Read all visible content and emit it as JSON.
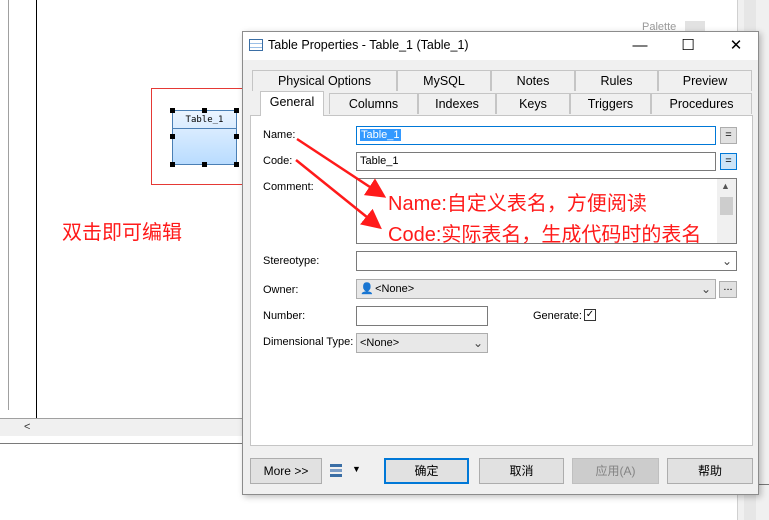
{
  "background": {
    "palette_label": "Palette",
    "scroll_left_glyph": "<",
    "annotation_left": "双击即可编辑"
  },
  "table_symbol": {
    "name": "Table_1"
  },
  "dialog": {
    "title": "Table Properties - Table_1 (Table_1)",
    "window_buttons": {
      "minimize": "—",
      "maximize": "☐",
      "close": "✕"
    },
    "tabs_row1": [
      "Physical Options",
      "MySQL",
      "Notes",
      "Rules",
      "Preview"
    ],
    "tabs_row2": [
      "General",
      "Columns",
      "Indexes",
      "Keys",
      "Triggers",
      "Procedures"
    ],
    "active_tab": "General",
    "fields": {
      "name_label": "Name:",
      "name_value": "Table_1",
      "code_label": "Code:",
      "code_value": "Table_1",
      "comment_label": "Comment:",
      "stereotype_label": "Stereotype:",
      "stereotype_value": "",
      "owner_label": "Owner:",
      "owner_value": "<None>",
      "number_label": "Number:",
      "number_value": "",
      "generate_label": "Generate:",
      "generate_checked": true,
      "dimensional_label": "Dimensional Type:",
      "dimensional_value": "<None>"
    },
    "eq_glyph": "=",
    "more_glyph": "...",
    "buttons": {
      "more": "More >>",
      "ok": "确定",
      "cancel": "取消",
      "apply": "应用(A)",
      "help": "帮助"
    },
    "annotations": {
      "name_note": "Name:自定义表名，方便阅读",
      "code_note": "Code:实际表名，生成代码时的表名"
    }
  },
  "colors": {
    "annotation": "#ff1a1a",
    "selection": "#3399ff",
    "ok_border": "#0078d7"
  }
}
